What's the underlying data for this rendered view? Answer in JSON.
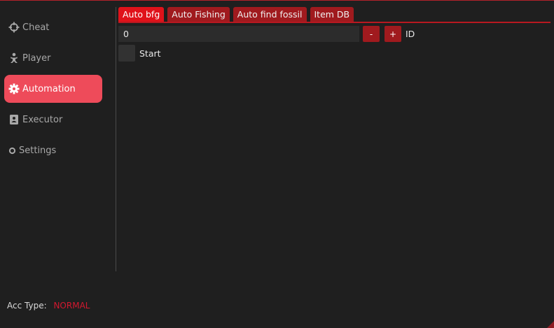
{
  "sidebar": {
    "items": [
      {
        "label": "Cheat",
        "icon": "crosshair-icon"
      },
      {
        "label": "Player",
        "icon": "player-icon"
      },
      {
        "label": "Automation",
        "icon": "gear-icon",
        "active": true
      },
      {
        "label": "Executor",
        "icon": "contact-card-icon"
      },
      {
        "label": "Settings",
        "icon": "settings-dot-icon"
      }
    ],
    "account": {
      "label": "Acc Type:",
      "value": "NORMAL",
      "value_color": "#d2182f"
    }
  },
  "tabs": [
    {
      "label": "Auto bfg",
      "active": true
    },
    {
      "label": "Auto Fishing"
    },
    {
      "label": "Auto find fossil"
    },
    {
      "label": "Item DB"
    }
  ],
  "content": {
    "id_value": "0",
    "decrement_label": "-",
    "increment_label": "+",
    "id_label": "ID",
    "start_checked": false,
    "start_label": "Start"
  },
  "colors": {
    "accent": "#ee4b5a",
    "tab_active": "#e0121a",
    "tab_inactive": "#a01a1e",
    "background": "#1f1f1f"
  }
}
